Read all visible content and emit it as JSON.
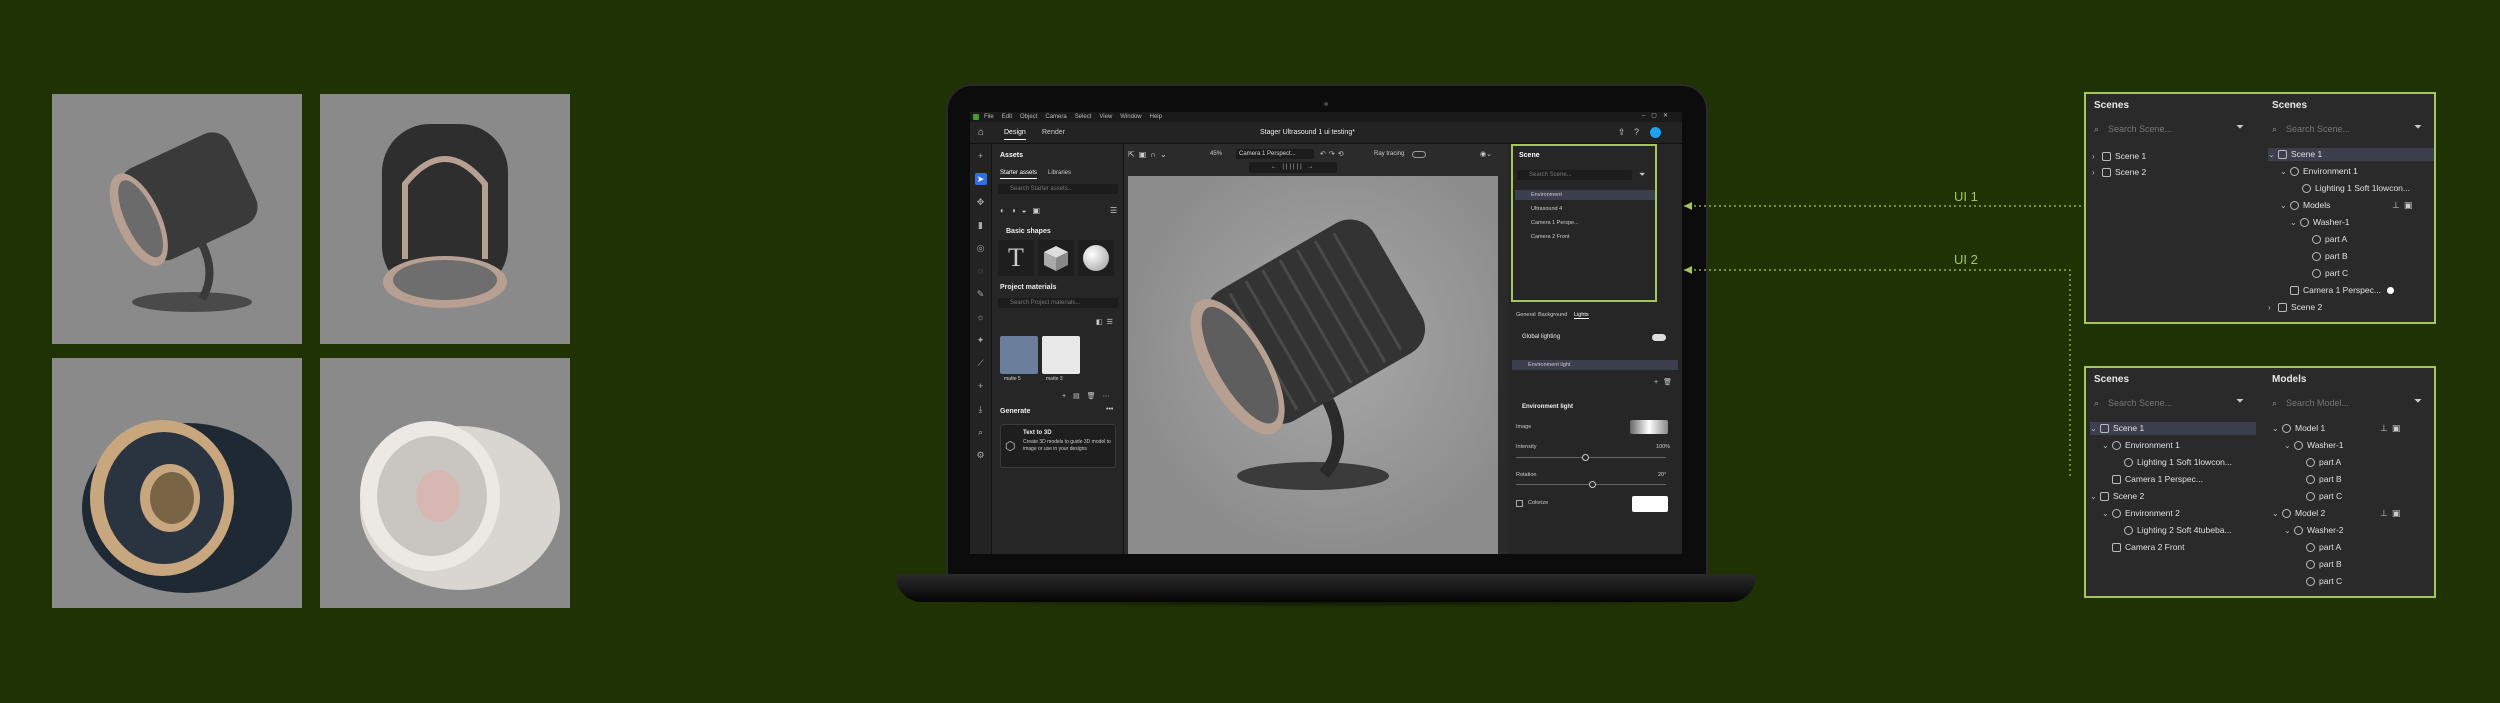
{
  "window": {
    "menu": [
      "File",
      "Edit",
      "Object",
      "Camera",
      "Select",
      "View",
      "Window",
      "Help"
    ],
    "tabs": [
      "Design",
      "Render"
    ],
    "doc_title": "Stager Ultrasound 1 ui testing*",
    "zoom": "45%",
    "camera": "Camera 1 Perspect...",
    "raytracing": "Ray tracing"
  },
  "assets": {
    "title": "Assets",
    "tabs": [
      "Starter assets",
      "Libraries"
    ],
    "search_placeholder": "Search Starter assets...",
    "basic_shapes": "Basic shapes",
    "project_materials": "Project materials",
    "materials_search": "Search Project materials...",
    "swatches": [
      "matte 5",
      "matte 3"
    ],
    "generate": "Generate",
    "text_to_3d_title": "Text to 3D",
    "text_to_3d_desc": "Create 3D models to guide 3D model to image or use in your designs"
  },
  "scene_panel": {
    "title": "Scene",
    "search_placeholder": "Search Scene...",
    "items": [
      "Environment",
      "Ultrasound 4",
      "Camera 1 Perspe...",
      "Camera 2 Front"
    ],
    "tabs": [
      "General",
      "Background",
      "Lights"
    ],
    "global_lighting": "Global lighting",
    "env_light_item": "Environment light",
    "env_light_section": "Environment light",
    "image_label": "Image",
    "intensity_label": "Intensity",
    "intensity_value": "100%",
    "rotation_label": "Rotation",
    "rotation_value": "20°",
    "colorize_label": "Colorize"
  },
  "labels": {
    "ui1": "UI 1",
    "ui2": "UI 2"
  },
  "ui1": {
    "left": {
      "title": "Scenes",
      "search": "Search Scene...",
      "items": [
        "Scene 1",
        "Scene 2"
      ]
    },
    "right": {
      "title": "Scenes",
      "search": "Search Scene...",
      "items": [
        "Scene 1",
        "Environment 1",
        "Lighting 1 Soft 1lowcon...",
        "Models",
        "Washer-1",
        "part A",
        "part B",
        "part C",
        "Camera 1 Perspec...",
        "Scene 2"
      ]
    }
  },
  "ui2": {
    "left": {
      "title": "Scenes",
      "search": "Search Scene...",
      "items": [
        "Scene 1",
        "Environment 1",
        "Lighting 1 Soft 1lowcon...",
        "Camera 1 Perspec...",
        "Scene 2",
        "Environment 2",
        "Lighting 2 Soft 4tubeba...",
        "Camera 2 Front"
      ]
    },
    "right": {
      "title": "Models",
      "search": "Search Model...",
      "items": [
        "Model 1",
        "Washer-1",
        "part A",
        "part B",
        "part C",
        "Model 2",
        "Washer-2",
        "part A",
        "part B",
        "part C"
      ]
    }
  },
  "colors": {
    "background": "#1e3203",
    "accent": "#a7c65a",
    "selection": "#3c3f4e"
  }
}
